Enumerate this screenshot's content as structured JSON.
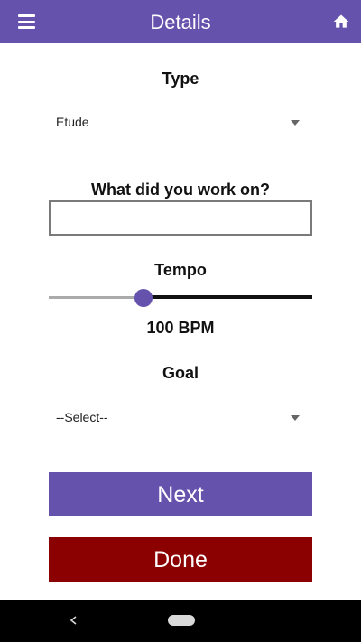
{
  "appbar": {
    "title": "Details",
    "menu_icon": "hamburger-menu-icon",
    "home_icon": "home-icon",
    "color": "#6552ad"
  },
  "type_field": {
    "label": "Type",
    "value": "Etude"
  },
  "work_field": {
    "label": "What did you work on?",
    "value": ""
  },
  "tempo_field": {
    "label": "Tempo",
    "value_text": "100 BPM",
    "slider_fraction": 0.36
  },
  "goal_field": {
    "label": "Goal",
    "value": "--Select--"
  },
  "buttons": {
    "next_label": "Next",
    "next_color": "#6552ad",
    "done_label": "Done",
    "done_color": "#8b0000"
  },
  "system_nav": {
    "back_icon": "back-arrow-icon",
    "home_icon": "home-pill-icon"
  }
}
